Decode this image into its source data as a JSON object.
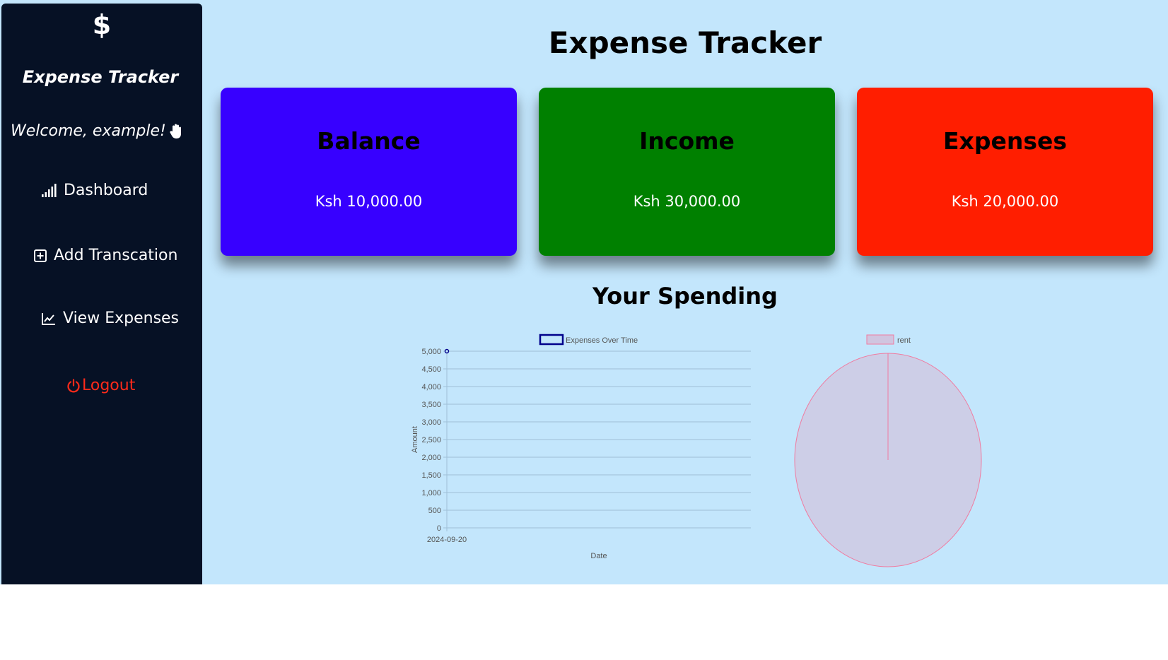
{
  "colors": {
    "sidebar_bg": "#061125",
    "page_bg": "#c3e6fc",
    "balance": "#3700ff",
    "income": "#008000",
    "expenses": "#ff1e00",
    "logout": "#ff2a1a"
  },
  "sidebar": {
    "logo_icon": "$",
    "brand": "Expense Tracker",
    "welcome": "Welcome, example!",
    "welcome_icon": "hand-wave-icon",
    "items": [
      {
        "label": "Dashboard",
        "icon": "signal-bars-icon"
      },
      {
        "label": "Add Transcation",
        "icon": "plus-square-icon"
      },
      {
        "label": "View Expenses",
        "icon": "line-chart-icon"
      }
    ],
    "logout": {
      "label": "Logout",
      "icon": "power-icon"
    }
  },
  "main": {
    "title": "Expense Tracker",
    "cards": [
      {
        "title": "Balance",
        "value": "Ksh 10,000.00",
        "color": "#3700ff"
      },
      {
        "title": "Income",
        "value": "Ksh 30,000.00",
        "color": "#008000"
      },
      {
        "title": "Expenses",
        "value": "Ksh 20,000.00",
        "color": "#ff1e00"
      }
    ],
    "spending_title": "Your Spending"
  },
  "chart_data": [
    {
      "type": "line",
      "legend": [
        "Expenses Over Time"
      ],
      "legend_position": "top",
      "x": [
        "2024-09-20"
      ],
      "series": [
        {
          "name": "Expenses Over Time",
          "values": [
            5000
          ],
          "color": "#00008b"
        }
      ],
      "xlabel": "Date",
      "ylabel": "Amount",
      "ylim": [
        0,
        5000
      ],
      "yticks": [
        "0",
        "500",
        "1,000",
        "1,500",
        "2,000",
        "2,500",
        "3,000",
        "3,500",
        "4,000",
        "4,500",
        "5,000"
      ],
      "grid": true
    },
    {
      "type": "pie",
      "legend_position": "top",
      "categories": [
        "rent"
      ],
      "values": [
        5000
      ],
      "colors": [
        "#f07ba0"
      ]
    }
  ]
}
